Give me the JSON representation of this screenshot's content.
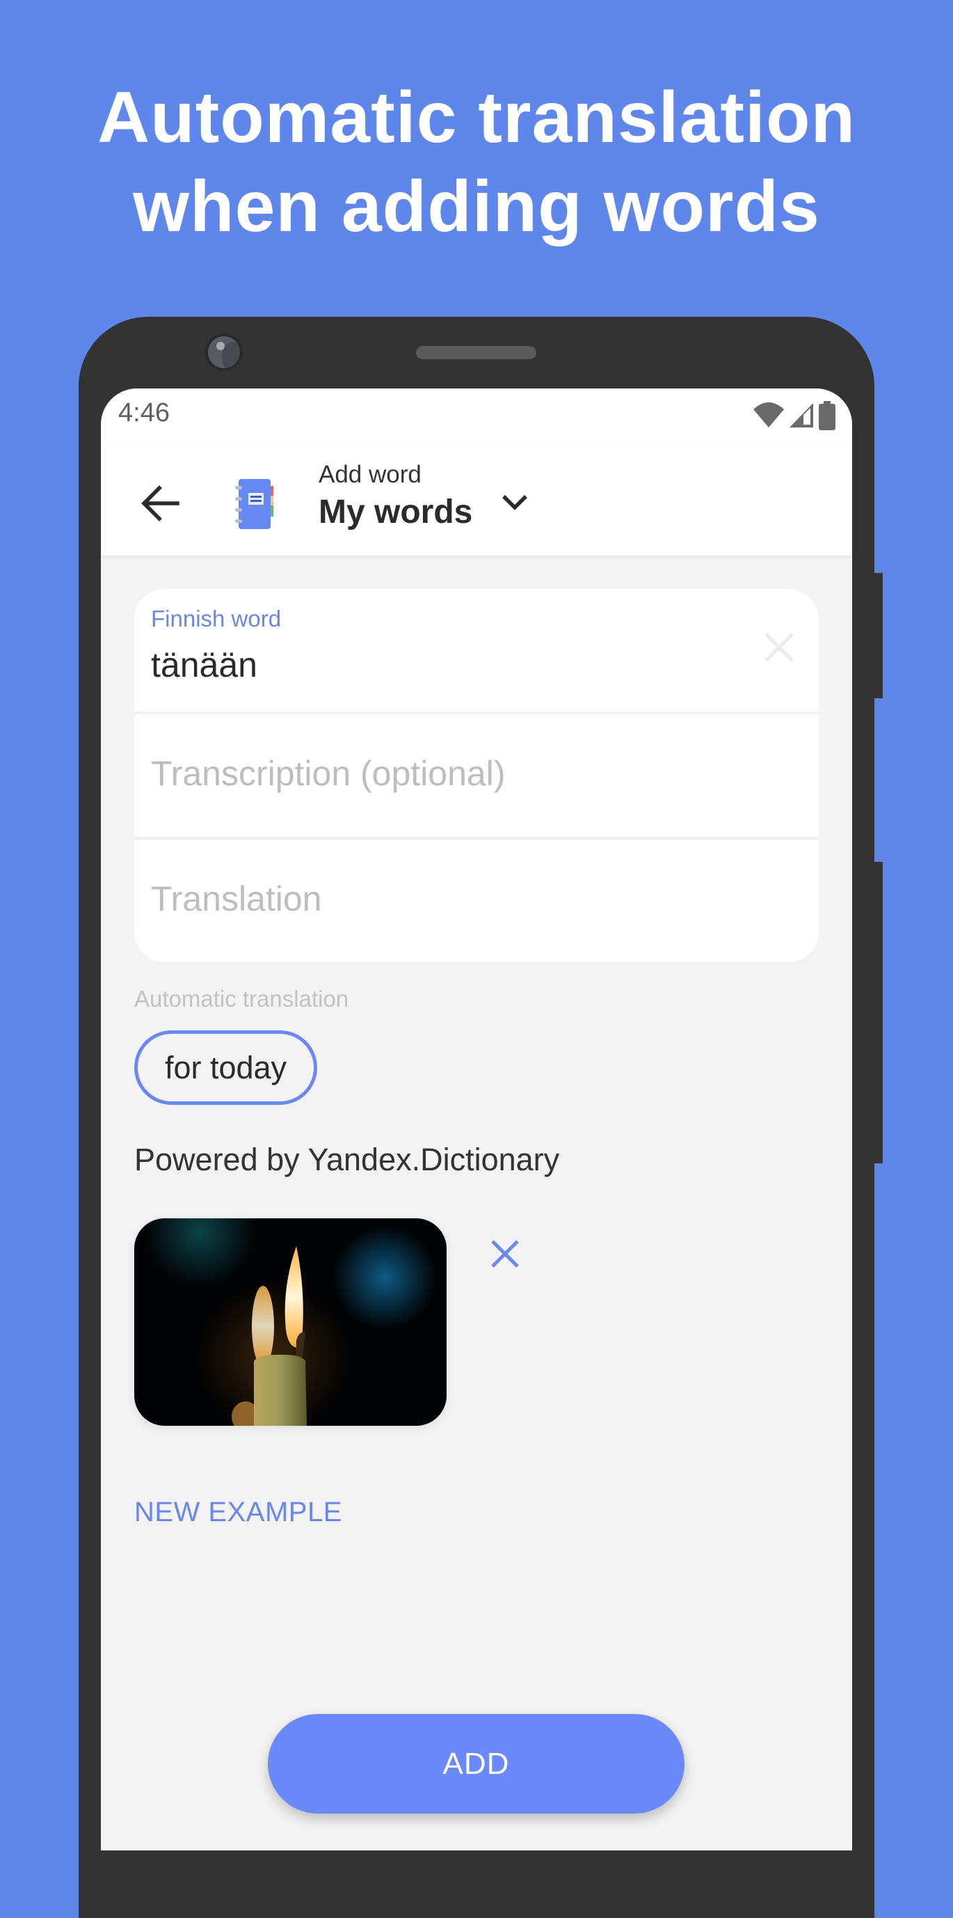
{
  "promo": {
    "headline_line1": "Automatic translation",
    "headline_line2": "when adding words"
  },
  "status_bar": {
    "time": "4:46",
    "icons": [
      "wifi-icon",
      "cellular-signal-icon",
      "battery-icon"
    ]
  },
  "toolbar": {
    "back_icon": "arrow-left-icon",
    "dictionary_icon": "notebook-icon",
    "subtitle": "Add word",
    "title": "My words",
    "dropdown_icon": "chevron-down-icon"
  },
  "form": {
    "word_field": {
      "label": "Finnish word",
      "value": "tänään",
      "clear_icon": "close-icon"
    },
    "transcription_field": {
      "placeholder": "Transcription (optional)",
      "value": ""
    },
    "translation_field": {
      "placeholder": "Translation",
      "value": ""
    }
  },
  "auto_translation": {
    "label": "Automatic translation",
    "suggestions": [
      "for today"
    ],
    "attribution": "Powered by Yandex.Dictionary"
  },
  "image": {
    "description": "candle flame in the dark",
    "remove_icon": "close-icon"
  },
  "actions": {
    "new_example_label": "NEW EXAMPLE",
    "add_label": "ADD"
  },
  "colors": {
    "background": "#5f86eb",
    "accent": "#6a89fb",
    "phone_frame": "#333333",
    "screen_bg": "#f3f3f3"
  }
}
